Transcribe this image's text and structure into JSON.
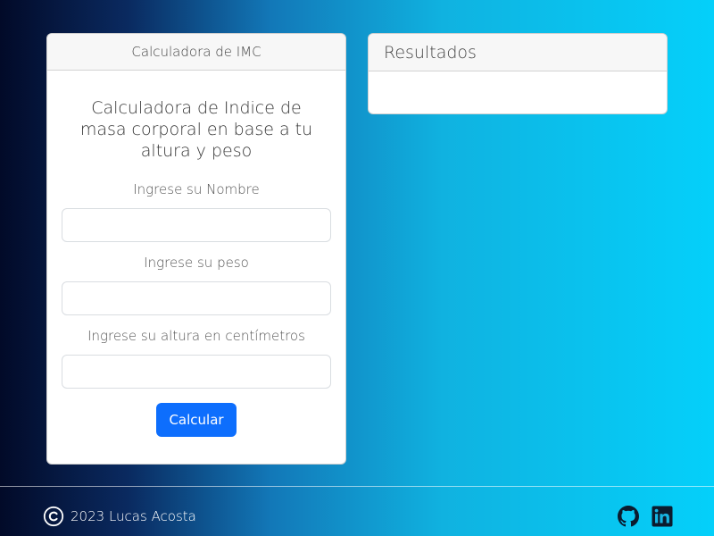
{
  "calculator": {
    "header": "Calculadora de IMC",
    "title": "Calculadora de Indice de masa corporal en base a tu altura y peso",
    "name_label": "Ingrese su Nombre",
    "name_value": "",
    "weight_label": "Ingrese su peso",
    "weight_value": "",
    "height_label": "Ingrese su altura en centímetros",
    "height_value": "",
    "button_label": "Calcular"
  },
  "results": {
    "header": "Resultados"
  },
  "footer": {
    "copyright_text": "2023 Lucas Acosta",
    "icons": [
      "copyright-icon",
      "github-icon",
      "linkedin-icon"
    ]
  },
  "colors": {
    "button": "#0d6efd",
    "gradient_left": "#020a28",
    "gradient_right": "#04d0fa"
  }
}
